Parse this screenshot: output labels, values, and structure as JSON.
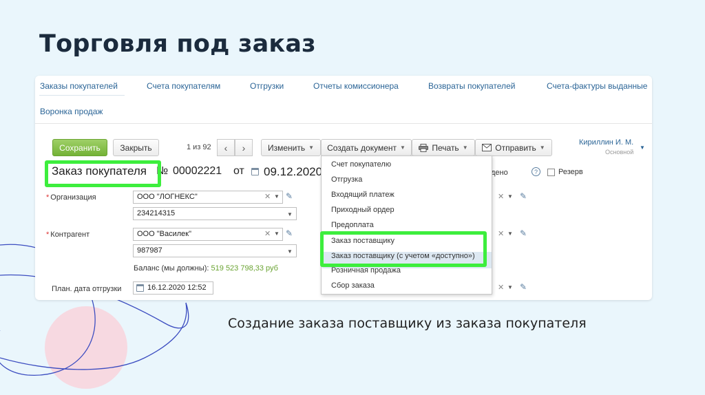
{
  "slide": {
    "title": "Торговля под заказ",
    "caption": "Создание заказа поставщику из заказа покупателя"
  },
  "tabs": [
    "Заказы покупателей",
    "Счета покупателям",
    "Отгрузки",
    "Отчеты комиссионера",
    "Возвраты покупателей",
    "Счета-фактуры выданные",
    "Воронка продаж"
  ],
  "toolbar": {
    "save_label": "Сохранить",
    "close_label": "Закрыть",
    "pager": "1 из 92",
    "prev": "‹",
    "next": "›",
    "edit_label": "Изменить",
    "create_doc_label": "Создать документ",
    "print_label": "Печать",
    "send_label": "Отправить"
  },
  "user": {
    "name": "Кириллин И. М.",
    "role": "Основной"
  },
  "document": {
    "title": "Заказ покупателя",
    "no_label": "№",
    "number": "00002221",
    "from_label": "от",
    "date": "09.12.2020"
  },
  "form": {
    "org_label": "Организация",
    "org_value": "ООО \"ЛОГНЕКС\"",
    "org_code": "234214315",
    "contractor_label": "Контрагент",
    "contractor_value": "ООО \"Василек\"",
    "contractor_code": "987987",
    "balance_label": "Баланс (мы должны):",
    "balance_value": "519 523 798,33 руб",
    "ship_date_label": "План. дата отгрузки",
    "ship_date_value": "16.12.2020 12:52"
  },
  "right_panel": {
    "partial_text": "дено",
    "reserve_label": "Резерв",
    "help": "?"
  },
  "create_menu": [
    "Счет покупателю",
    "Отгрузка",
    "Входящий платеж",
    "Приходный ордер",
    "Предоплата",
    "Заказ поставщику",
    "Заказ поставщику (с учетом «доступно»)",
    "Розничная продажа",
    "Сбор заказа"
  ],
  "colors": {
    "accent_green": "#3dee3d",
    "save_button": "#73b236",
    "link_blue": "#2a6496",
    "title_dark": "#1b2b3d"
  }
}
